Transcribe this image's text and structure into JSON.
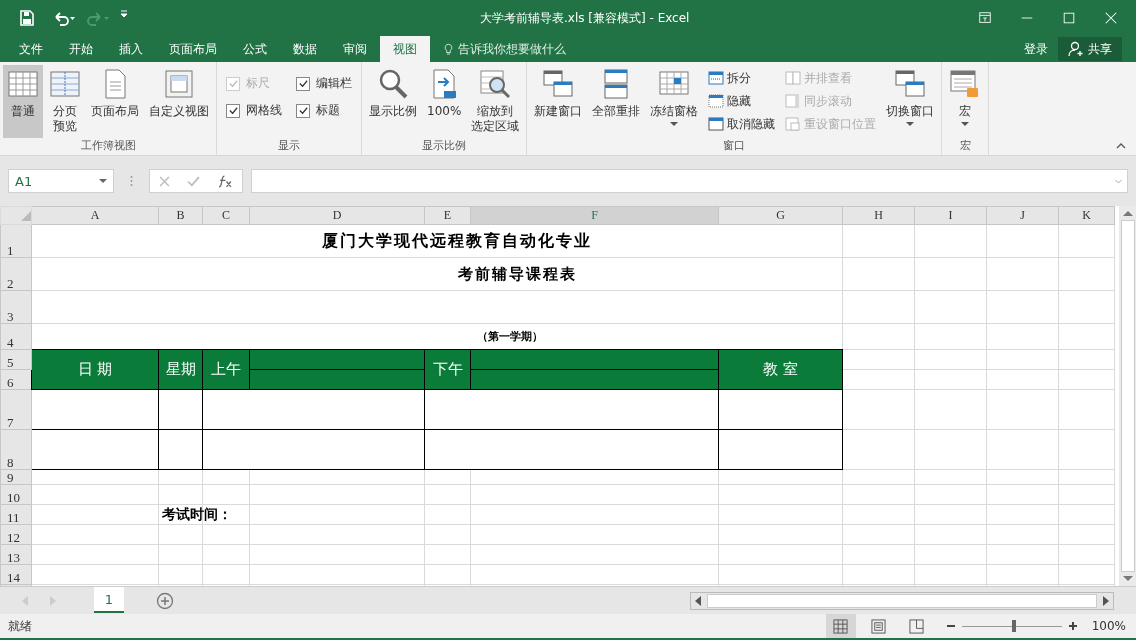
{
  "title_bar": {
    "quick_access": [
      {
        "kind": "save",
        "disabled": false
      },
      {
        "kind": "undo",
        "disabled": false
      },
      {
        "kind": "redo",
        "disabled": true
      },
      {
        "kind": "customize",
        "disabled": false
      }
    ],
    "title": "大学考前辅导表.xls  [兼容模式] - Excel"
  },
  "tabs": [
    {
      "label": "文件",
      "selected": false
    },
    {
      "label": "开始",
      "selected": false
    },
    {
      "label": "插入",
      "selected": false
    },
    {
      "label": "页面布局",
      "selected": false
    },
    {
      "label": "公式",
      "selected": false
    },
    {
      "label": "数据",
      "selected": false
    },
    {
      "label": "审阅",
      "selected": false
    },
    {
      "label": "视图",
      "selected": true
    }
  ],
  "tell_me": "告诉我你想要做什么",
  "sign_in": "登录",
  "share": "共享",
  "ribbon": {
    "groups": [
      {
        "label": "工作簿视图",
        "items": [
          {
            "kind": "large",
            "lines": [
              "普通"
            ],
            "selected": true
          },
          {
            "kind": "large",
            "lines": [
              "分页",
              "预览"
            ],
            "selected": false
          },
          {
            "kind": "large",
            "lines": [
              "页面布局"
            ],
            "selected": false
          },
          {
            "kind": "large",
            "lines": [
              "自定义视图"
            ],
            "selected": false
          }
        ]
      },
      {
        "label": "显示",
        "items": [
          {
            "kind": "checkbox",
            "lines": [
              "标尺"
            ],
            "checked": true,
            "disabled": true
          },
          {
            "kind": "checkbox",
            "lines": [
              "编辑栏"
            ],
            "checked": true,
            "disabled": false
          },
          {
            "kind": "checkbox",
            "lines": [
              "网格线"
            ],
            "checked": true,
            "disabled": false
          },
          {
            "kind": "checkbox",
            "lines": [
              "标题"
            ],
            "checked": true,
            "disabled": false
          }
        ]
      },
      {
        "label": "显示比例",
        "items": [
          {
            "kind": "large",
            "lines": [
              "显示比例"
            ]
          },
          {
            "kind": "large",
            "lines": [
              "100%"
            ]
          },
          {
            "kind": "large",
            "lines": [
              "缩放到",
              "选定区域"
            ]
          }
        ]
      },
      {
        "label": "窗口",
        "items": [
          {
            "kind": "large",
            "lines": [
              "新建窗口"
            ]
          },
          {
            "kind": "large",
            "lines": [
              "全部重排"
            ]
          },
          {
            "kind": "large",
            "lines": [
              "冻结窗格"
            ],
            "dropdown": true
          },
          {
            "kind": "small",
            "lines": [
              "拆分"
            ],
            "disabled": false
          },
          {
            "kind": "small",
            "lines": [
              "隐藏"
            ],
            "disabled": false
          },
          {
            "kind": "small",
            "lines": [
              "取消隐藏"
            ],
            "disabled": false
          },
          {
            "kind": "small",
            "lines": [
              "并排查看"
            ],
            "disabled": true
          },
          {
            "kind": "small",
            "lines": [
              "同步滚动"
            ],
            "disabled": true
          },
          {
            "kind": "small",
            "lines": [
              "重设窗口位置"
            ],
            "disabled": true
          },
          {
            "kind": "large",
            "lines": [
              "切换窗口"
            ],
            "dropdown": true
          }
        ]
      },
      {
        "label": "宏",
        "items": [
          {
            "kind": "large",
            "lines": [
              "宏"
            ],
            "dropdown": true
          }
        ]
      }
    ]
  },
  "formula_bar": {
    "name_box": "A1"
  },
  "sheet": {
    "columns": [
      {
        "label": "A",
        "selected": false
      },
      {
        "label": "B",
        "selected": false
      },
      {
        "label": "C",
        "selected": false
      },
      {
        "label": "D",
        "selected": false
      },
      {
        "label": "E",
        "selected": false
      },
      {
        "label": "F",
        "selected": true
      },
      {
        "label": "G",
        "selected": false
      },
      {
        "label": "H",
        "selected": false
      },
      {
        "label": "I",
        "selected": false
      },
      {
        "label": "J",
        "selected": false
      },
      {
        "label": "K",
        "selected": false
      }
    ],
    "rows": [
      "1",
      "2",
      "3",
      "4",
      "5",
      "6",
      "7",
      "8",
      "9",
      "10",
      "11",
      "12",
      "13",
      "14"
    ],
    "title": "厦门大学现代远程教育自动化专业",
    "subtitle": "考前辅导课程表",
    "term": "（第一学期）",
    "headers": [
      "日 期",
      "星期",
      "上午",
      "下午",
      "教 室"
    ],
    "exam_label": "考试时间："
  },
  "sheet_tabs": [
    {
      "label": "1",
      "selected": true
    }
  ],
  "status_bar": {
    "status": "就绪",
    "views": [
      {
        "kind": "normal",
        "selected": true
      },
      {
        "kind": "page_layout",
        "selected": false
      },
      {
        "kind": "page_break",
        "selected": false
      }
    ],
    "zoom": {
      "level": 0.52,
      "reading": "100%"
    }
  }
}
